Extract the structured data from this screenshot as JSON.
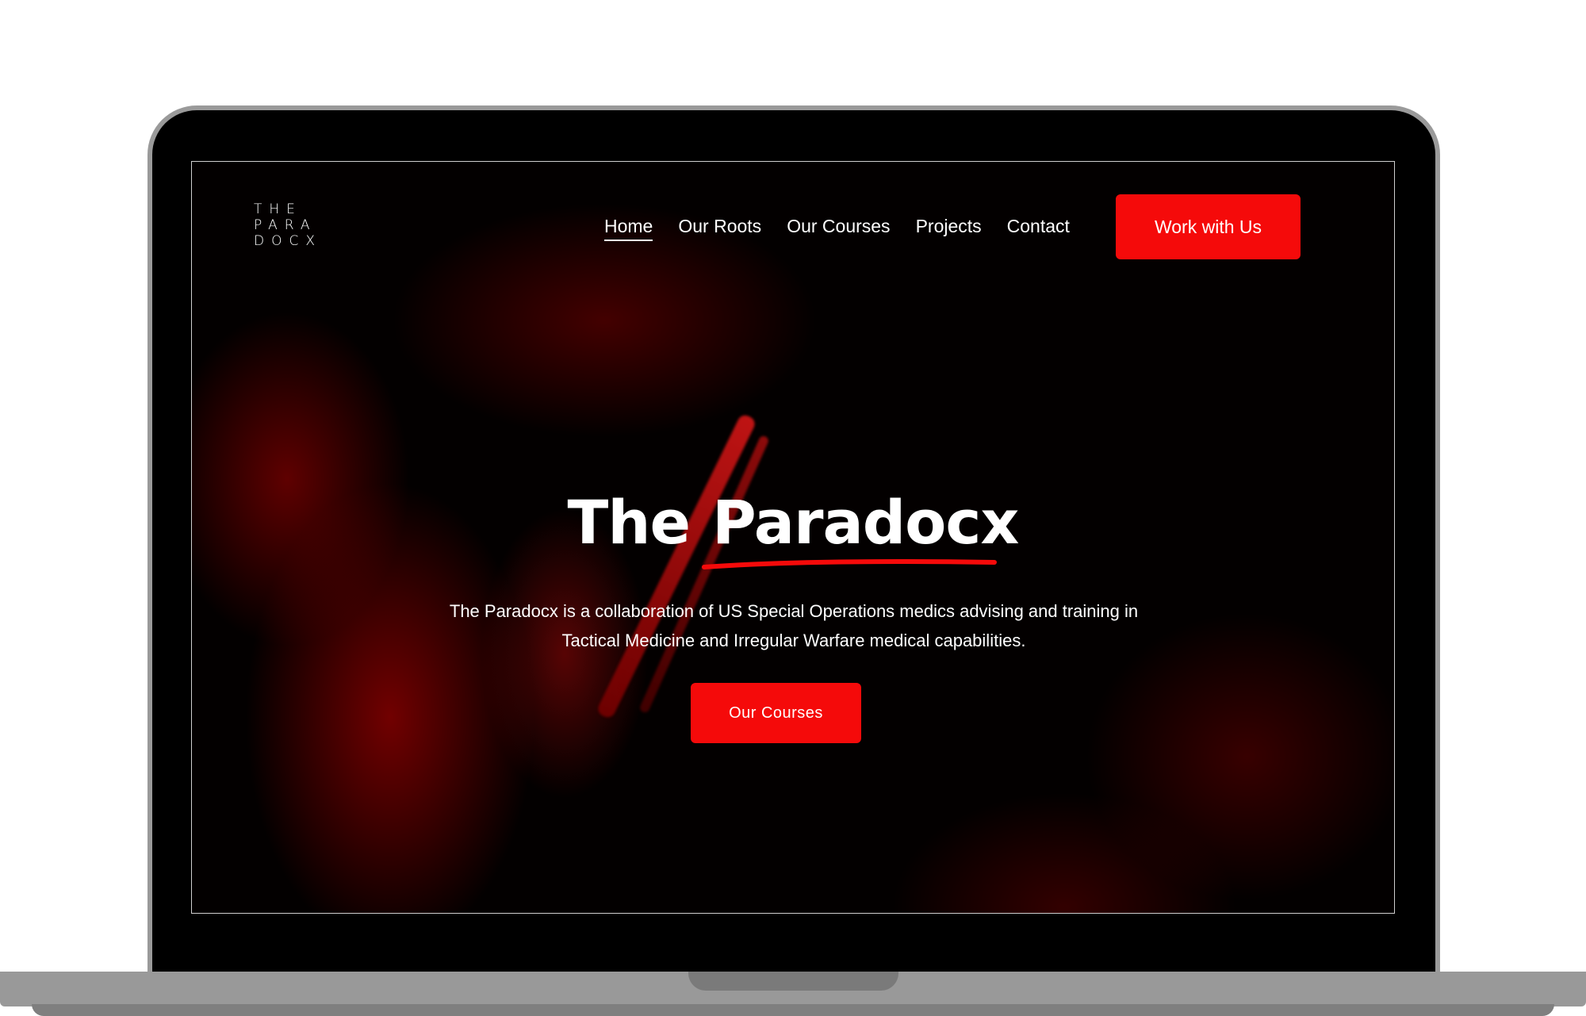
{
  "logo": {
    "line1": "THE",
    "line2": "PARA",
    "line3": "DOCX"
  },
  "nav": {
    "items": [
      "Home",
      "Our Roots",
      "Our Courses",
      "Projects",
      "Contact"
    ],
    "active": "Home"
  },
  "header": {
    "cta_label": "Work with Us"
  },
  "hero": {
    "title_word1": "The",
    "title_word2": "Paradocx",
    "description": "The Paradocx is a collaboration of US Special Operations medics advising and training in Tactical Medicine and Irregular Warfare medical capabilities.",
    "button_label": "Our Courses"
  },
  "colors": {
    "accent": "#f50a0a",
    "background": "#030000",
    "text": "#ffffff"
  }
}
